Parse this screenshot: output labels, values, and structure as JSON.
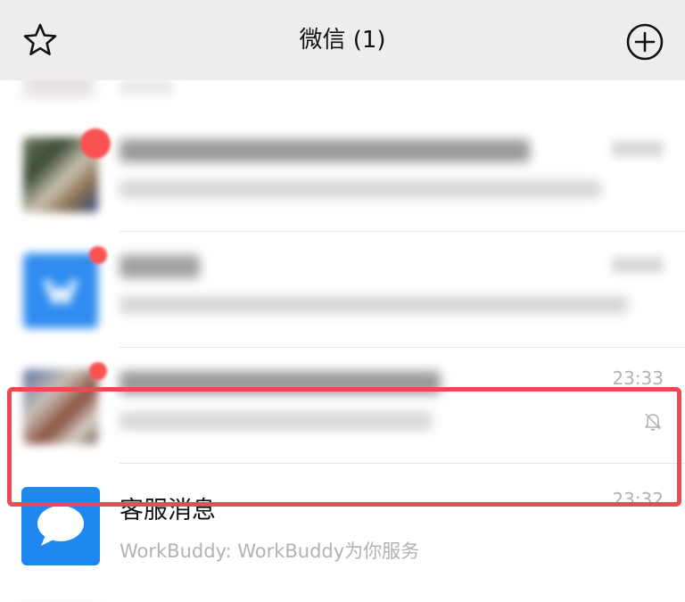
{
  "header": {
    "title": "微信 (1)",
    "left_icon": "star-icon",
    "right_icon": "plus-circle-icon"
  },
  "chats": [
    {
      "kind": "blurred",
      "avatar_style": "photo-collage",
      "has_badge": true
    },
    {
      "kind": "blurred",
      "avatar_style": "blue-icon",
      "has_badge": true
    },
    {
      "kind": "blurred-partial",
      "avatar_style": "photo-collage",
      "has_badge": true,
      "time": "23:33",
      "muted": true,
      "mute_icon": "bell-off-icon"
    },
    {
      "kind": "visible",
      "name": "客服消息",
      "message": "WorkBuddy: WorkBuddy为你服务",
      "time": "23:32",
      "avatar_icon": "chat-bubble-icon",
      "highlighted": true
    }
  ],
  "colors": {
    "header_bg": "#ededed",
    "highlight_border": "#ea4a52",
    "kefu_avatar": "#1e88f0",
    "badge": "#fa5151",
    "muted_text": "#b2b2b2"
  }
}
